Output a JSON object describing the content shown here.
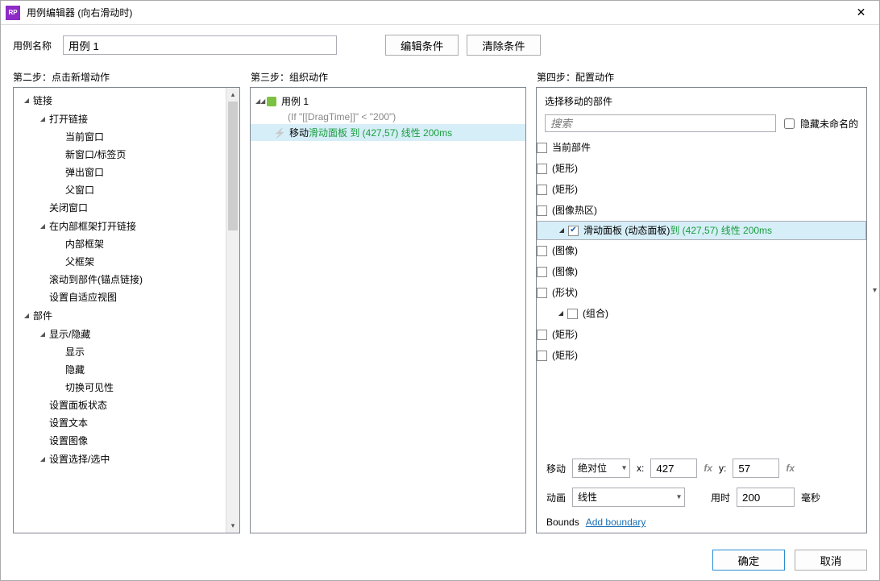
{
  "window": {
    "title": "用例编辑器 (向右滑动时)",
    "app_icon_text": "RP"
  },
  "row1": {
    "label": "用例名称",
    "value": "用例 1",
    "edit_cond": "编辑条件",
    "clear_cond": "清除条件"
  },
  "steps": {
    "s2": "第二步：点击新增动作",
    "s3": "第三步：组织动作",
    "s4": "第四步：配置动作"
  },
  "actions_tree": {
    "a0": "链接",
    "a1": "打开链接",
    "a1a": "当前窗口",
    "a1b": "新窗口/标签页",
    "a1c": "弹出窗口",
    "a1d": "父窗口",
    "a2": "关闭窗口",
    "a3": "在内部框架打开链接",
    "a3a": "内部框架",
    "a3b": "父框架",
    "a4": "滚动到部件(锚点链接)",
    "a5": "设置自适应视图",
    "b0": "部件",
    "b1": "显示/隐藏",
    "b1a": "显示",
    "b1b": "隐藏",
    "b1c": "切换可见性",
    "b2": "设置面板状态",
    "b3": "设置文本",
    "b4": "设置图像",
    "b5": "设置选择/选中"
  },
  "case_panel": {
    "case_name": "用例 1",
    "condition": "(If \"[[DragTime]]\" < \"200\")",
    "act_prefix": "移动 ",
    "act_green": "滑动面板 到 (427,57) 线性 200ms"
  },
  "config": {
    "title": "选择移动的部件",
    "search_ph": "搜索",
    "hide_unnamed": "隐藏未命名的",
    "items": {
      "i0": "当前部件",
      "i1": "(矩形)",
      "i2": "(矩形)",
      "i3": "(图像热区)",
      "i4_pre": "滑动面板 (动态面板) ",
      "i4_green": "到 (427,57) 线性 200ms",
      "i5": "(图像)",
      "i6": "(图像)",
      "i7": "(形状)",
      "i8": "(组合)",
      "i9": "(矩形)",
      "i10": "(矩形)"
    },
    "move_lbl": "移动",
    "move_sel": "绝对位",
    "x_lbl": "x:",
    "x_val": "427",
    "y_lbl": "y:",
    "y_val": "57",
    "anim_lbl": "动画",
    "anim_sel": "线性",
    "dur_lbl": "用时",
    "dur_val": "200",
    "ms": "毫秒",
    "bounds_lbl": "Bounds",
    "bounds_link": "Add boundary"
  },
  "footer": {
    "ok": "确定",
    "cancel": "取消"
  }
}
